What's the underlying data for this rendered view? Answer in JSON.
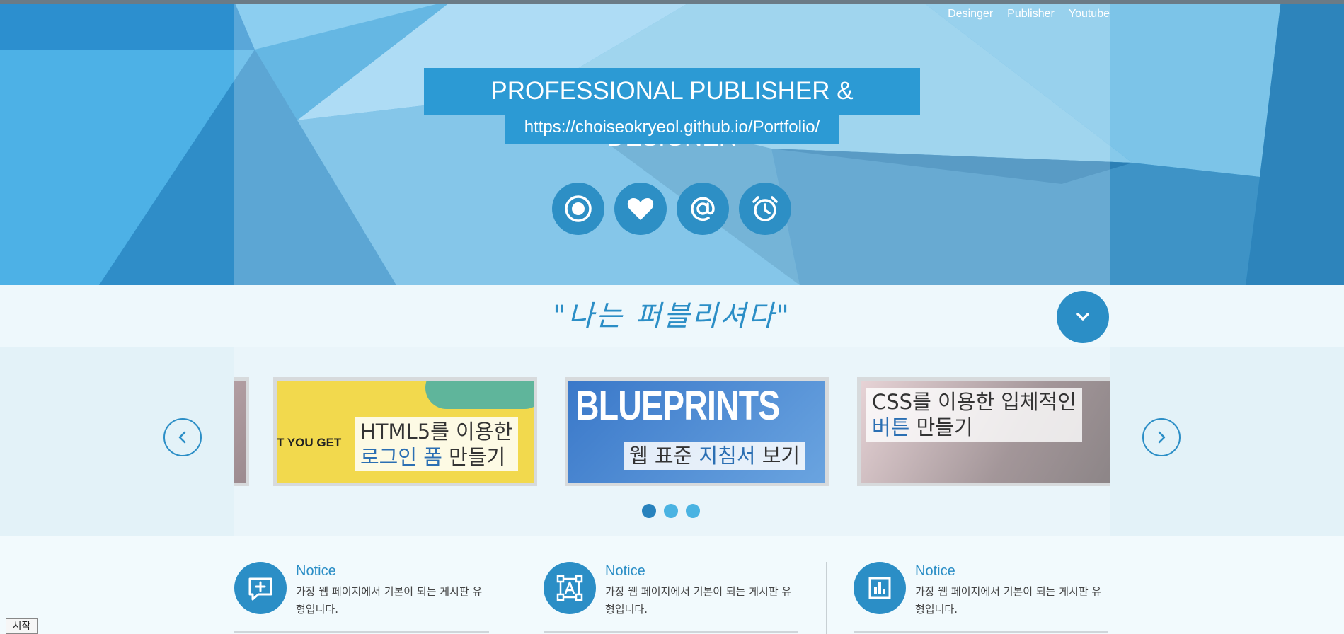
{
  "nav": {
    "items": [
      "Desinger",
      "Publisher",
      "Youtube"
    ]
  },
  "hero": {
    "title": "PROFESSIONAL PUBLISHER & DESIGNER",
    "url": "https://choiseokryeol.github.io/Portfolio/",
    "social_icons": [
      "target-icon",
      "heart-icon",
      "at-icon",
      "alarm-clock-icon"
    ]
  },
  "tagline": "\"나는 퍼블리셔다\"",
  "carousel": {
    "slides": [
      {
        "image_text": "T YOU GET",
        "caption_line1": "HTML5를 이용한",
        "caption_line2_accent": "로그인 폼",
        "caption_line2_rest": " 만들기"
      },
      {
        "image_text": "BLUEPRINTS",
        "caption_pre": "웹 표준 ",
        "caption_accent": "지침서",
        "caption_post": " 보기"
      },
      {
        "caption_line1": "CSS를 이용한 입체적인",
        "caption_line2_accent": "버튼",
        "caption_line2_rest": " 만들기"
      }
    ],
    "dots": 3,
    "active_dot": 0
  },
  "notices": [
    {
      "title": "Notice",
      "desc": "가장 웹 페이지에서 기본이 되는 게시판 유형입니다.",
      "icon": "comment-plus-icon"
    },
    {
      "title": "Notice",
      "desc": "가장 웹 페이지에서 기본이 되는 게시판 유형입니다.",
      "icon": "font-select-icon"
    },
    {
      "title": "Notice",
      "desc": "가장 웹 페이지에서 기본이 되는 게시판 유형입니다.",
      "icon": "bar-chart-icon"
    }
  ],
  "taskbar": {
    "start": "시작"
  },
  "colors": {
    "accent": "#2b8ec6",
    "hero_blue": "#2c9ad4",
    "dot": "#4ab3e2"
  }
}
